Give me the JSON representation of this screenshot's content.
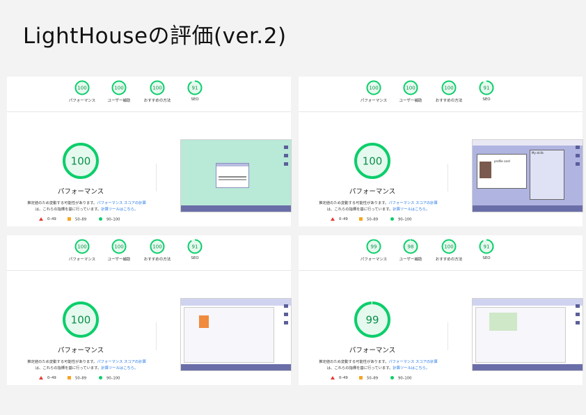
{
  "title": "LightHouseの評価(ver.2)",
  "colors": {
    "pass": "#0cce6b",
    "average": "#f5a623",
    "fail": "#e53935",
    "link": "#1a73e8"
  },
  "panels": [
    {
      "scores": [
        {
          "value": 100,
          "label": "パフォーマンス"
        },
        {
          "value": 100,
          "label": "ユーザー補助"
        },
        {
          "value": 100,
          "label": "おすすめの方法"
        },
        {
          "value": 91,
          "label": "SEO"
        }
      ],
      "main_score": 100,
      "main_label": "パフォーマンス",
      "desc_text": "推定値のため変動する可能性があります。",
      "desc_link1": "パフォーマンス スコアの計算",
      "desc_text2": "は、これらの指標を基に行っています。",
      "desc_link2": "計算ツールはこちら。",
      "legend": {
        "fail": "0–49",
        "average": "50–89",
        "pass": "90–100"
      }
    },
    {
      "scores": [
        {
          "value": 100,
          "label": "パフォーマンス"
        },
        {
          "value": 100,
          "label": "ユーザー補助"
        },
        {
          "value": 100,
          "label": "おすすめの方法"
        },
        {
          "value": 91,
          "label": "SEO"
        }
      ],
      "main_score": 100,
      "main_label": "パフォーマンス",
      "desc_text": "推定値のため変動する可能性があります。",
      "desc_link1": "パフォーマンス スコアの計算",
      "desc_text2": "は、これらの指標を基に行っています。",
      "desc_link2": "計算ツールはこちら。",
      "legend": {
        "fail": "0–49",
        "average": "50–89",
        "pass": "90–100"
      },
      "thumb_text": {
        "heading": "My skills",
        "card": "profile card"
      }
    },
    {
      "scores": [
        {
          "value": 100,
          "label": "パフォーマンス"
        },
        {
          "value": 100,
          "label": "ユーザー補助"
        },
        {
          "value": 100,
          "label": "おすすめの方法"
        },
        {
          "value": 91,
          "label": "SEO"
        }
      ],
      "main_score": 100,
      "main_label": "パフォーマンス",
      "desc_text": "推定値のため変動する可能性があります。",
      "desc_link1": "パフォーマンス スコアの計算",
      "desc_text2": "は、これらの指標を基に行っています。",
      "desc_link2": "計算ツールはこちら。",
      "legend": {
        "fail": "0–49",
        "average": "50–89",
        "pass": "90–100"
      }
    },
    {
      "scores": [
        {
          "value": 99,
          "label": "パフォーマンス"
        },
        {
          "value": 98,
          "label": "ユーザー補助"
        },
        {
          "value": 100,
          "label": "おすすめの方法"
        },
        {
          "value": 91,
          "label": "SEO"
        }
      ],
      "main_score": 99,
      "main_label": "パフォーマンス",
      "desc_text": "推定値のため変動する可能性があります。",
      "desc_link1": "パフォーマンス スコアの計算",
      "desc_text2": "は、これらの指標を基に行っています。",
      "desc_link2": "計算ツールはこちら。",
      "legend": {
        "fail": "0–49",
        "average": "50–89",
        "pass": "90–100"
      }
    }
  ]
}
